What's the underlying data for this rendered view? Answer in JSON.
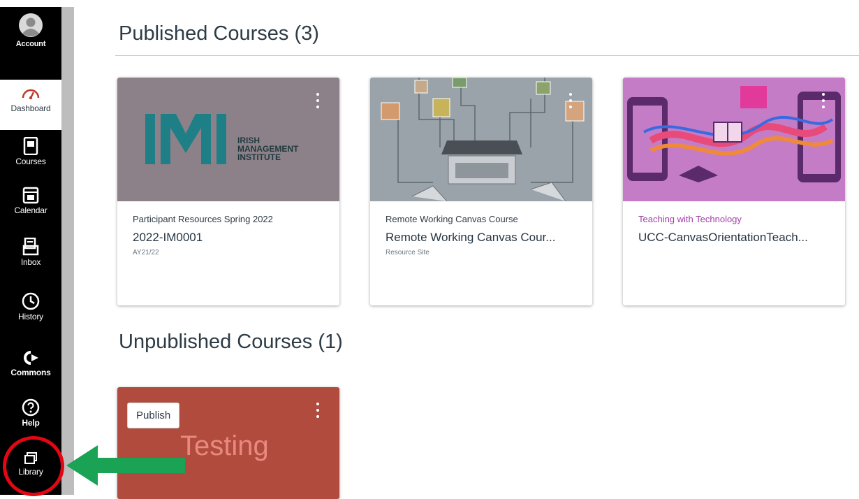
{
  "nav": {
    "items": [
      {
        "label": "Account",
        "icon": "user-avatar-icon"
      },
      {
        "label": "Dashboard",
        "icon": "dashboard-icon"
      },
      {
        "label": "Courses",
        "icon": "courses-icon"
      },
      {
        "label": "Calendar",
        "icon": "calendar-icon"
      },
      {
        "label": "Inbox",
        "icon": "inbox-icon"
      },
      {
        "label": "History",
        "icon": "clock-icon"
      },
      {
        "label": "Commons",
        "icon": "commons-icon"
      },
      {
        "label": "Help",
        "icon": "help-icon"
      },
      {
        "label": "Library",
        "icon": "library-icon"
      }
    ],
    "active": "Dashboard"
  },
  "published": {
    "heading": "Published Courses (3)",
    "cards": [
      {
        "term": "Participant Resources Spring 2022",
        "code": "2022-IM0001",
        "sub": "AY21/22",
        "logo_lines": [
          "IRISH",
          "MANAGEMENT",
          "INSTITUTE"
        ],
        "hero_color": "#8d8189"
      },
      {
        "term": "Remote Working Canvas Course",
        "code": "Remote Working Canvas Cour...",
        "sub": "Resource Site",
        "hero_color": "#9aa3aa"
      },
      {
        "term": "Teaching with Technology",
        "code": "UCC-CanvasOrientationTeach...",
        "sub": "",
        "hero_color": "#c57cc6"
      }
    ]
  },
  "unpublished": {
    "heading": "Unpublished Courses (1)",
    "cards": [
      {
        "publish_label": "Publish",
        "title": "Testing",
        "hero_color": "#b04b3d"
      }
    ]
  },
  "colors": {
    "nav_bg": "#000000",
    "accent": "#c03a2b",
    "annotation_circle": "#e30613",
    "annotation_arrow": "#1aa355"
  }
}
